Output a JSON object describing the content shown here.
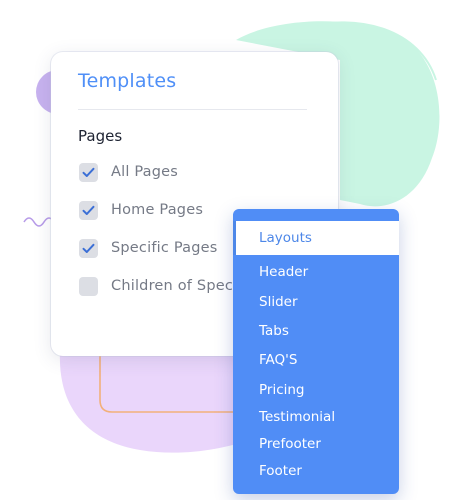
{
  "panel": {
    "title": "Templates",
    "section_label": "Pages",
    "options": [
      {
        "label": "All Pages",
        "checked": true
      },
      {
        "label": "Home Pages",
        "checked": true
      },
      {
        "label": "Specific Pages",
        "checked": true
      },
      {
        "label": "Children of Specific Pages",
        "checked": false
      }
    ]
  },
  "menu": {
    "items": [
      {
        "label": "Layouts",
        "active": true
      },
      {
        "label": "Header",
        "active": false
      },
      {
        "label": "Slider",
        "active": false
      },
      {
        "label": "Tabs",
        "active": false
      },
      {
        "label": "FAQ'S",
        "active": false
      },
      {
        "label": "Pricing",
        "active": false
      },
      {
        "label": "Testimonial",
        "active": false
      },
      {
        "label": "Prefooter",
        "active": false
      },
      {
        "label": "Footer",
        "active": false
      }
    ]
  },
  "colors": {
    "accent": "#4f8ff7",
    "menu_bg": "#508df6",
    "checkbox_bg": "#dcdee4",
    "check_mark": "#3b6fd6",
    "blob_mint": "#c9f5e3",
    "blob_lavender": "#ead6fb",
    "blob_purple": "#c7b2ef",
    "connector_orange": "#f2b07a"
  }
}
